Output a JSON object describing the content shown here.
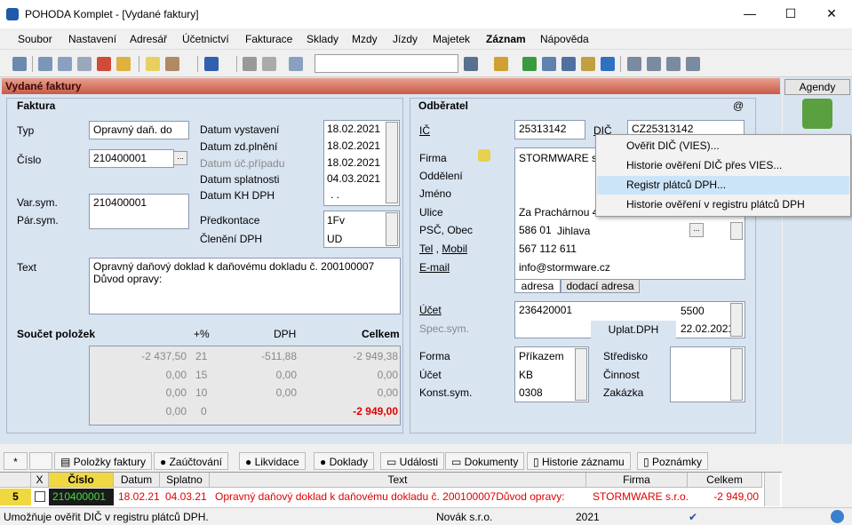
{
  "window": {
    "title": "POHODA Komplet - [Vydané faktury]",
    "min": "—",
    "max": "☐",
    "close": "✕"
  },
  "menu": [
    "Soubor",
    "Nastavení",
    "Adresář",
    "Účetnictví",
    "Fakturace",
    "Sklady",
    "Mzdy",
    "Jízdy",
    "Majetek",
    "Záznam",
    "Nápověda"
  ],
  "agenda": {
    "title": "Vydané faktury",
    "side_button": "Agendy"
  },
  "faktura": {
    "section": "Faktura",
    "typ_label": "Typ",
    "typ_value": "Opravný daň. do",
    "cislo_label": "Číslo",
    "cislo_value": "210400001",
    "varsym_label": "Var.sym.",
    "varsym_value": "210400001",
    "parsym_label": "Pár.sym.",
    "datum_vystaveni_label": "Datum vystavení",
    "datum_vystaveni": "18.02.2021",
    "datum_zd_label": "Datum zd.plnění",
    "datum_zd": "18.02.2021",
    "datum_uc_label": "Datum úč.případu",
    "datum_uc": "18.02.2021",
    "datum_splatnosti_label": "Datum splatnosti",
    "datum_splatnosti": "04.03.2021",
    "datum_kh_label": "Datum KH DPH",
    "datum_kh": ". .",
    "predkontace_label": "Předkontace",
    "predkontace": "1Fv",
    "cleneni_label": "Členění DPH",
    "cleneni": "UD",
    "text_label": "Text",
    "text_value": "Opravný daňový doklad k daňovému dokladu č. 200100007\nDůvod opravy:"
  },
  "soucet": {
    "label": "Součet položek",
    "h_pct": "+%",
    "h_dph": "DPH",
    "h_celkem": "Celkem",
    "rows": [
      {
        "base": "-2 437,50",
        "pct": "21",
        "dph": "-511,88",
        "celkem": "-2 949,38"
      },
      {
        "base": "0,00",
        "pct": "15",
        "dph": "0,00",
        "celkem": "0,00"
      },
      {
        "base": "0,00",
        "pct": "10",
        "dph": "0,00",
        "celkem": "0,00"
      },
      {
        "base": "0,00",
        "pct": "0",
        "dph": "",
        "celkem": "-2 949,00"
      }
    ]
  },
  "odberatel": {
    "section": "Odběratel",
    "at": "@",
    "ic_label": "IČ",
    "ic": "25313142",
    "dic_label": "DIČ",
    "dic": "CZ25313142",
    "firma_label": "Firma",
    "firma": "STORMWARE s.r.",
    "oddeleni_label": "Oddělení",
    "jmeno_label": "Jméno",
    "ulice_label": "Ulice",
    "ulice": "Za Prachárnou 4",
    "psc_label": "PSČ, Obec",
    "psc": "586 01",
    "obec": "Jihlava",
    "tel_label": "Tel",
    "mobil_label": "Mobil",
    "tel": "567 112 611",
    "email_label": "E-mail",
    "email": "info@stormware.cz",
    "tab_adresa": "adresa",
    "tab_dodaci": "dodací adresa",
    "ucet_label": "Účet",
    "ucet": "236420001",
    "ucet_kod": "5500",
    "specsym_label": "Spec.sym.",
    "uplat_label": "Uplat.DPH",
    "uplat": "22.02.2021",
    "forma_label": "Forma",
    "forma": "Příkazem",
    "ucet2_label": "Účet",
    "ucet2": "KB",
    "konst_label": "Konst.sym.",
    "konst": "0308",
    "stredisko_label": "Středisko",
    "cinnost_label": "Činnost",
    "zakazka_label": "Zakázka"
  },
  "context_menu": [
    "Ověřit DIČ (VIES)...",
    "Historie ověření DIČ přes VIES...",
    "Registr plátců DPH...",
    "Historie ověření v registru plátců DPH"
  ],
  "tabs": [
    "*",
    "",
    "Položky faktury",
    "Zaúčtování",
    "Likvidace",
    "Doklady",
    "Události",
    "Dokumenty",
    "Historie záznamu",
    "Poznámky"
  ],
  "grid": {
    "headers": [
      "X",
      "Číslo",
      "Datum",
      "Splatno",
      "Text",
      "Firma",
      "Celkem"
    ],
    "row": {
      "num": "5",
      "cislo": "210400001",
      "datum": "18.02.21",
      "splatno": "04.03.21",
      "text": "Opravný daňový doklad k daňovému dokladu č. 200100007Důvod opravy:",
      "firma": "STORMWARE s.r.o.",
      "celkem": "-2 949,00"
    }
  },
  "status": {
    "hint": "Umožňuje ověřit DIČ v registru plátců DPH.",
    "company": "Novák s.r.o.",
    "year": "2021"
  }
}
